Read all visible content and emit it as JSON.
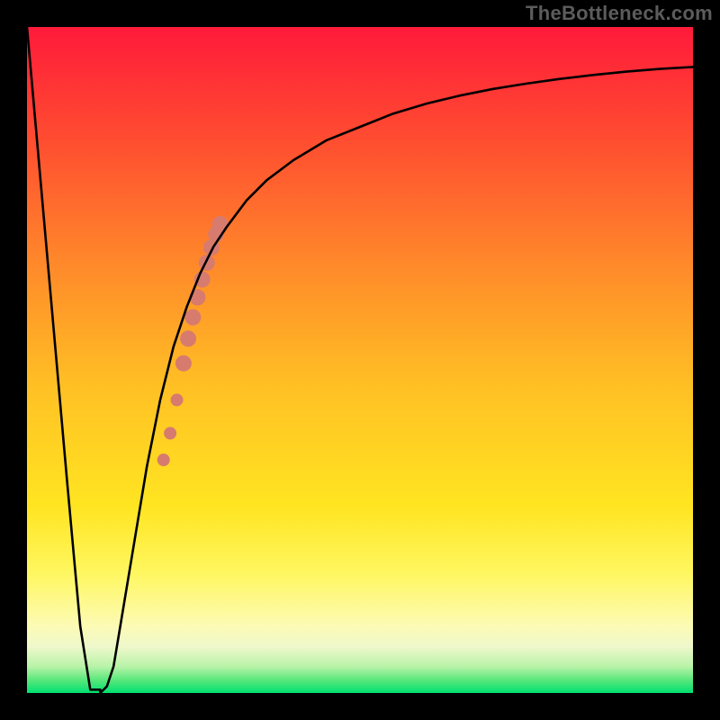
{
  "watermark": "TheBottleneck.com",
  "chart_data": {
    "type": "line",
    "title": "",
    "xlabel": "",
    "ylabel": "",
    "xlim": [
      0,
      100
    ],
    "ylim": [
      0,
      100
    ],
    "series": [
      {
        "name": "bottleneck-curve",
        "x": [
          0,
          3,
          6,
          8,
          10,
          11,
          12,
          13,
          14,
          16,
          18,
          20,
          22,
          24,
          26,
          28,
          30,
          33,
          36,
          40,
          45,
          50,
          55,
          60,
          65,
          70,
          75,
          80,
          85,
          90,
          95,
          100
        ],
        "values": [
          100,
          66,
          32,
          10,
          1,
          0,
          1,
          4,
          10,
          22,
          34,
          44,
          52,
          58,
          63,
          67,
          70,
          74,
          77,
          80,
          83,
          85,
          87,
          88.5,
          89.7,
          90.7,
          91.5,
          92.2,
          92.8,
          93.3,
          93.7,
          94
        ]
      }
    ],
    "valley_flat": {
      "x_start": 9.5,
      "x_end": 11,
      "y": 0.5
    },
    "highlight_points": {
      "name": "marker-cluster",
      "color": "#d77b6e",
      "points": [
        {
          "x": 20.5,
          "y": 35,
          "r": 7
        },
        {
          "x": 21.5,
          "y": 39,
          "r": 7
        },
        {
          "x": 22.5,
          "y": 44,
          "r": 7
        },
        {
          "x": 23.5,
          "y": 49.5,
          "r": 9
        },
        {
          "x": 24.2,
          "y": 53.2,
          "r": 9
        },
        {
          "x": 24.9,
          "y": 56.4,
          "r": 9
        },
        {
          "x": 25.6,
          "y": 59.4,
          "r": 9
        },
        {
          "x": 26.3,
          "y": 62.1,
          "r": 9
        },
        {
          "x": 27.0,
          "y": 64.6,
          "r": 9
        },
        {
          "x": 27.7,
          "y": 66.9,
          "r": 9
        },
        {
          "x": 28.4,
          "y": 68.9,
          "r": 9
        },
        {
          "x": 29.0,
          "y": 70.4,
          "r": 9
        }
      ]
    }
  }
}
